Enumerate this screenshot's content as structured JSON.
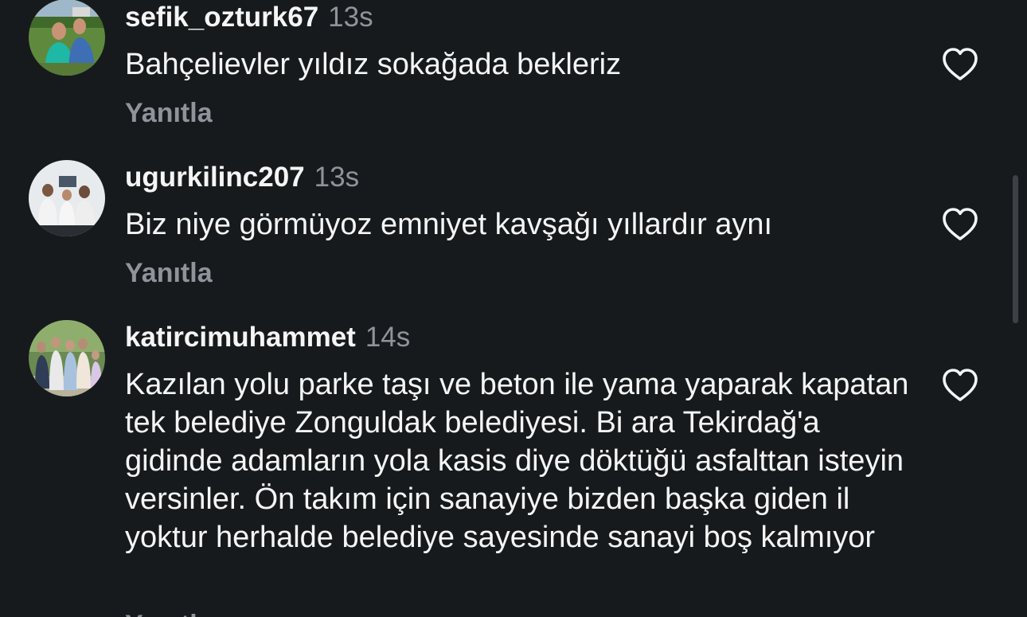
{
  "comments": [
    {
      "username": "sefik_ozturk67",
      "time": "13s",
      "text": "Bahçelievler yıldız sokağada bekleriz",
      "reply_label": "Yanıtla",
      "like_icon": "heart-outline-icon"
    },
    {
      "username": "ugurkilinc207",
      "time": "13s",
      "text": "Biz niye görmüyoz emniyet kavşağı yıllardır aynı",
      "reply_label": "Yanıtla",
      "like_icon": "heart-outline-icon"
    },
    {
      "username": "katircimuhammet",
      "time": "14s",
      "text": "Kazılan yolu parke taşı ve beton ile yama yaparak kapatan tek belediye Zonguldak belediyesi. Bi ara Tekirdağ'a gidinde adamların yola kasis diye döktüğü asfalttan isteyin versinler. Ön takım için sanayiye bizden başka giden il yoktur herhalde belediye sayesinde sanayi boş kalmıyor",
      "reply_label": "Yanıtla",
      "like_icon": "heart-outline-icon"
    }
  ],
  "colors": {
    "background": "#171a1d",
    "text": "#f5f5f5",
    "secondary": "#8f949b"
  }
}
